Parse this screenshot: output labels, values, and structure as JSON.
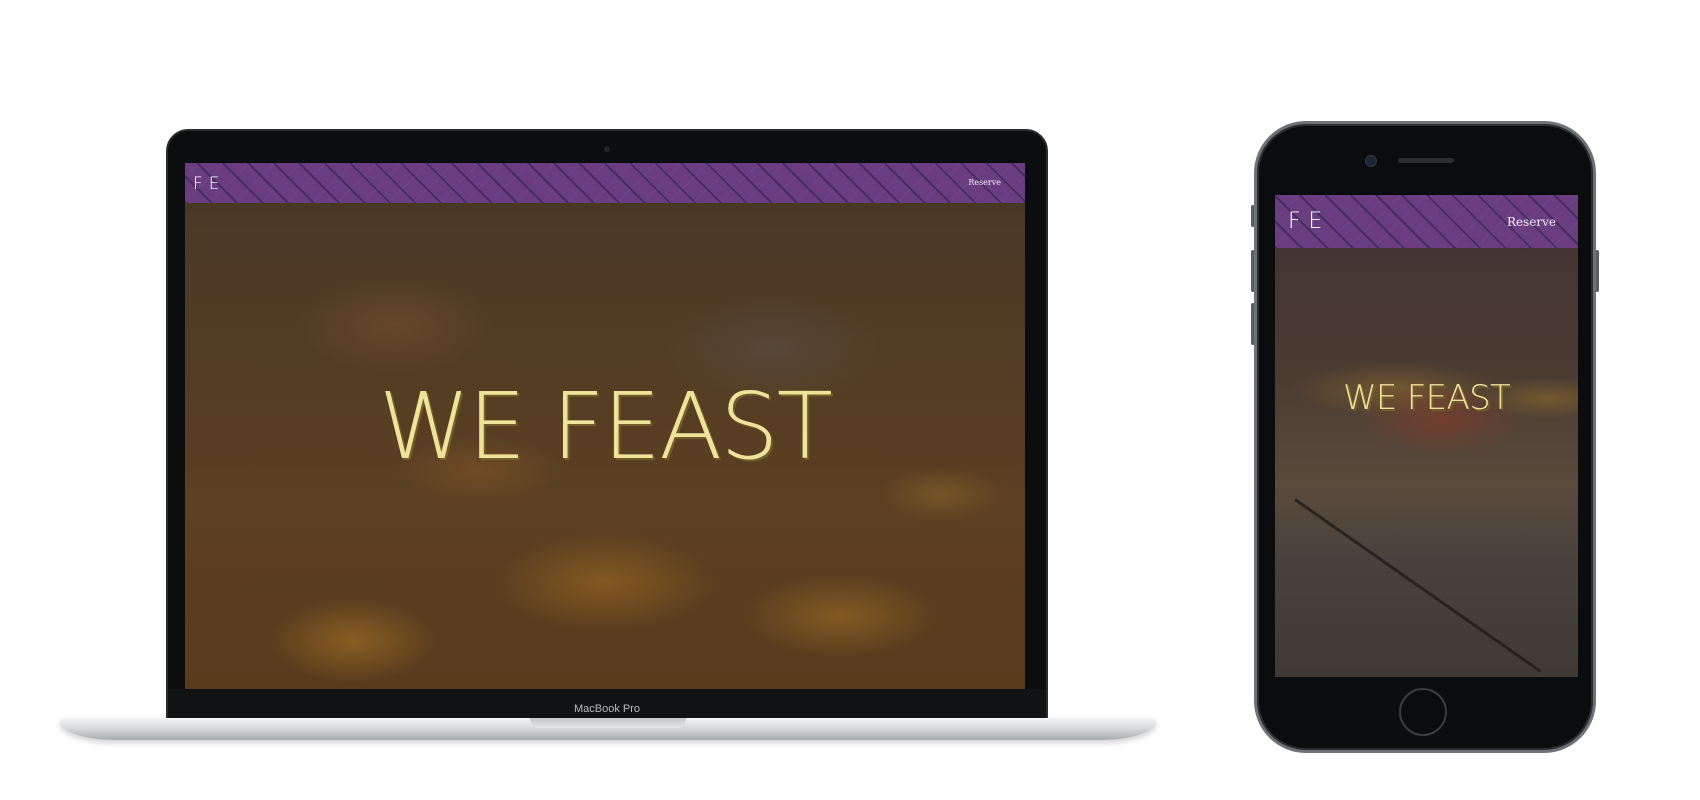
{
  "laptop": {
    "device_label": "MacBook Pro",
    "website": {
      "logo": "FE",
      "nav_link": "Reserve",
      "hero_title": "WE FEAST"
    }
  },
  "phone": {
    "website": {
      "logo": "FE",
      "nav_link": "Reserve",
      "hero_title": "WE FEAST"
    }
  },
  "colors": {
    "nav_purple": "#6a3d80",
    "hero_title_gold": "#efe39a"
  }
}
